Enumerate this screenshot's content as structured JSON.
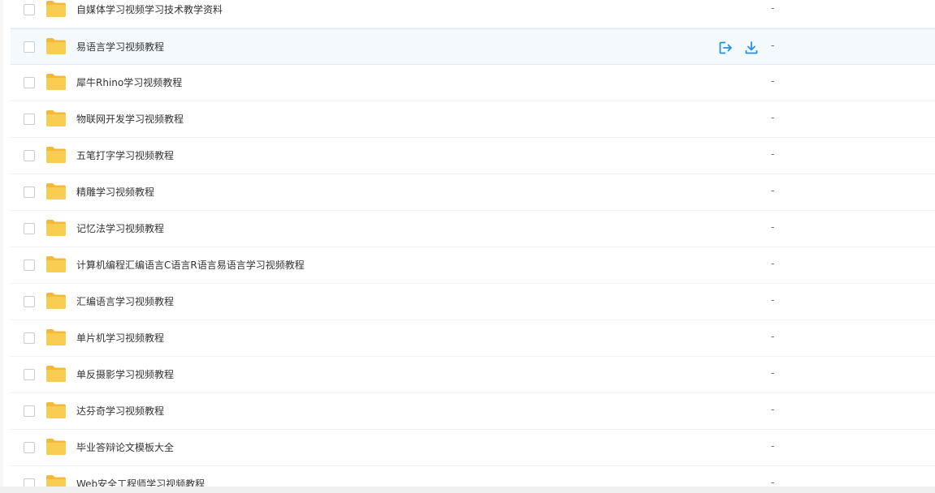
{
  "colors": {
    "folder": "#f8cd51",
    "folder_back": "#f5b93a",
    "accent": "#2292e6",
    "row_hover_bg": "#f4f9fd"
  },
  "file_list": {
    "rows": [
      {
        "name": "自媒体学习视频学习技术教学资料",
        "size": "-"
      },
      {
        "name": "易语言学习视频教程",
        "size": "-",
        "hover": true
      },
      {
        "name": "犀牛Rhino学习视频教程",
        "size": "-"
      },
      {
        "name": "物联网开发学习视频教程",
        "size": "-"
      },
      {
        "name": "五笔打字学习视频教程",
        "size": "-"
      },
      {
        "name": "精雕学习视频教程",
        "size": "-"
      },
      {
        "name": "记忆法学习视频教程",
        "size": "-"
      },
      {
        "name": "计算机编程汇编语言C语言R语言易语言学习视频教程",
        "size": "-"
      },
      {
        "name": "汇编语言学习视频教程",
        "size": "-"
      },
      {
        "name": "单片机学习视频教程",
        "size": "-"
      },
      {
        "name": "单反摄影学习视频教程",
        "size": "-"
      },
      {
        "name": "达芬奇学习视频教程",
        "size": "-"
      },
      {
        "name": "毕业答辩论文模板大全",
        "size": "-"
      },
      {
        "name": "Web安全工程师学习视频教程",
        "size": "-"
      }
    ],
    "row_actions": [
      "share-icon",
      "download-icon"
    ]
  }
}
